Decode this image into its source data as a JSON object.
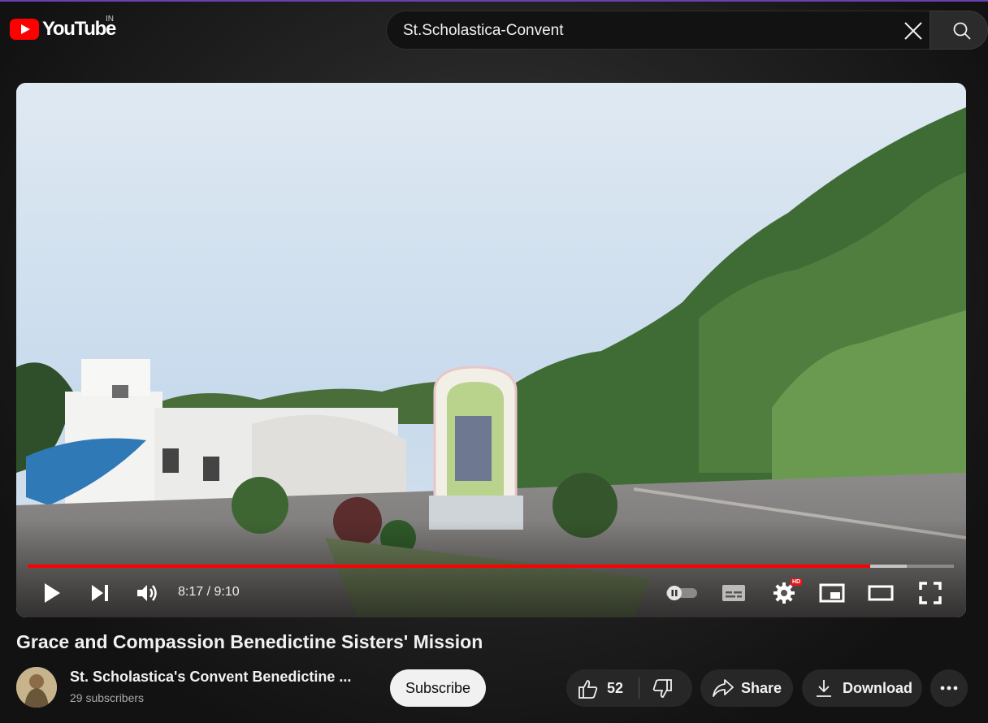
{
  "header": {
    "logo_text": "YouTube",
    "country_code": "IN",
    "search_query": "St.Scholastica-Convent"
  },
  "player": {
    "time_display": "8:17 / 9:10",
    "progress_fraction": 0.9096,
    "buffered_fraction": 0.9493,
    "quality_badge": "HD"
  },
  "video": {
    "title": "Grace and Compassion Benedictine Sisters' Mission",
    "channel_name": "St. Scholastica's Convent Benedictine ...",
    "subscribers": "29 subscribers",
    "subscribe_label": "Subscribe",
    "like_count": "52",
    "share_label": "Share",
    "download_label": "Download"
  },
  "colors": {
    "brand_red": "#ff0000",
    "background": "#0f0f0f",
    "pill_bg": "#272727"
  }
}
